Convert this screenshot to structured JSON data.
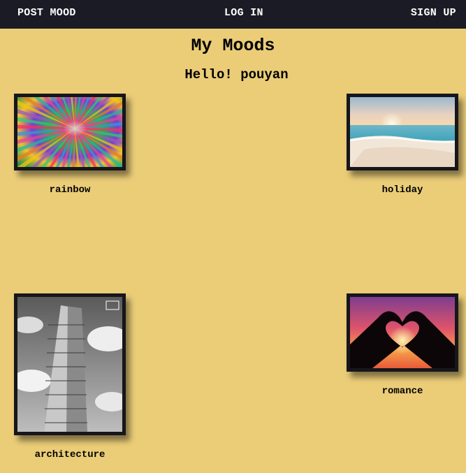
{
  "nav": {
    "post_mood": "POST MOOD",
    "log_in": "LOG IN",
    "sign_up": "SIGN UP"
  },
  "header": {
    "title": "My Moods",
    "greeting": "Hello! pouyan"
  },
  "moods": [
    {
      "caption": "rainbow",
      "image": "colorful-starburst-image"
    },
    {
      "caption": "holiday",
      "image": "beach-sunset-image"
    },
    {
      "caption": "architecture",
      "image": "flatiron-building-image"
    },
    {
      "caption": "romance",
      "image": "heart-hands-sunset-image"
    }
  ],
  "colors": {
    "background": "#ebcd78",
    "navbar": "#1a1b24",
    "frame": "#16161c"
  }
}
